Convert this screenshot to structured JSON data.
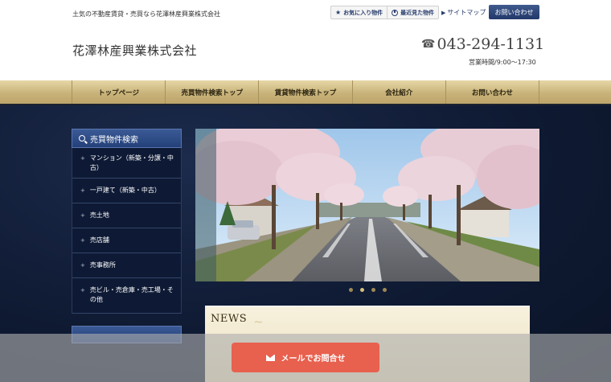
{
  "header": {
    "tagline": "土気の不動産賃貸・売買なら花澤林産興業株式会社",
    "favorites_label": "お気に入り物件",
    "recent_label": "最近見た物件",
    "sitemap_label": "サイトマップ",
    "contact_label": "お問い合わせ",
    "company_name": "花澤林産興業株式会社",
    "phone": "043-294-1131",
    "hours": "営業時間/9:00～17:30"
  },
  "nav": {
    "items": [
      {
        "label": "トップページ"
      },
      {
        "label": "売買物件検索トップ"
      },
      {
        "label": "賃貸物件検索トップ"
      },
      {
        "label": "会社紹介"
      },
      {
        "label": "お問い合わせ"
      }
    ]
  },
  "sidebar": {
    "title": "売買物件検索",
    "items": [
      {
        "label": "マンション（新築・分譲・中古）"
      },
      {
        "label": "一戸建て（新築・中古）"
      },
      {
        "label": "売土地"
      },
      {
        "label": "売店舗"
      },
      {
        "label": "売事務所"
      },
      {
        "label": "売ビル・売倉庫・売工場・その他"
      }
    ]
  },
  "slider": {
    "slide_count": 4,
    "active_index": 1
  },
  "news": {
    "title": "NEWS"
  },
  "footer_bar": {
    "mail_label": "メールでお問合せ"
  },
  "colors": {
    "navy": "#22386a",
    "gold": "#c8b37a",
    "mail_button": "#e8604e"
  }
}
